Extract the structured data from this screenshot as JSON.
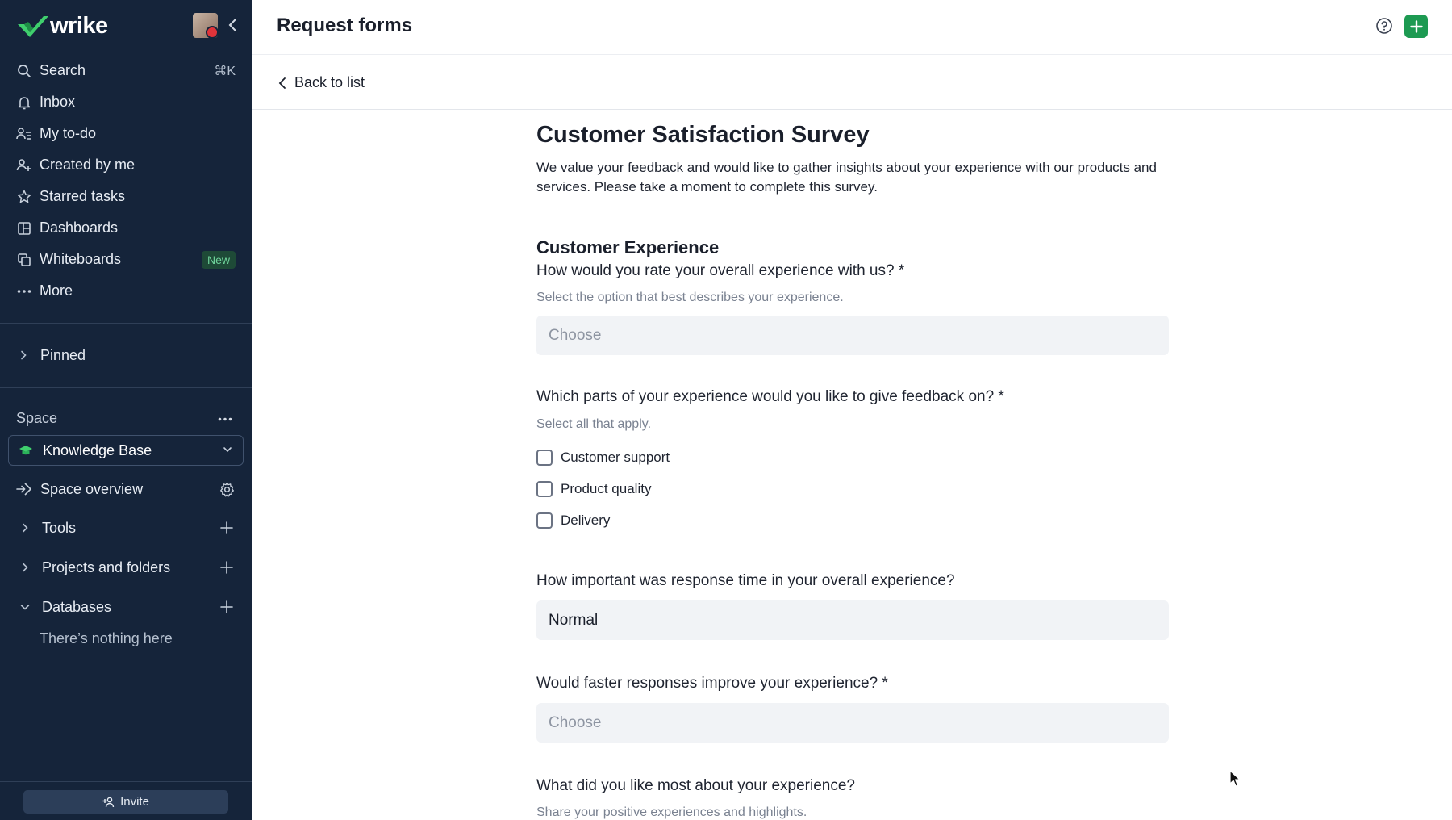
{
  "sidebar": {
    "brand": "wrike",
    "nav": [
      {
        "label": "Search",
        "icon": "search-icon",
        "shortcut": "⌘K"
      },
      {
        "label": "Inbox",
        "icon": "bell-icon"
      },
      {
        "label": "My to-do",
        "icon": "person-list-icon"
      },
      {
        "label": "Created by me",
        "icon": "person-plus-icon"
      },
      {
        "label": "Starred tasks",
        "icon": "star-icon"
      },
      {
        "label": "Dashboards",
        "icon": "dashboard-icon"
      },
      {
        "label": "Whiteboards",
        "icon": "whiteboard-icon",
        "badge": "New"
      },
      {
        "label": "More",
        "icon": "more-dots-icon"
      }
    ],
    "pinned_label": "Pinned",
    "space_label": "Space",
    "space_name": "Knowledge Base",
    "space_overview": "Space overview",
    "tools": "Tools",
    "projects": "Projects and folders",
    "databases": "Databases",
    "databases_empty": "There’s nothing here",
    "invite": "Invite"
  },
  "header": {
    "title": "Request forms",
    "back": "Back to list"
  },
  "form": {
    "title": "Customer Satisfaction Survey",
    "description": "We value your feedback and would like to gather insights about your experience with our products and services. Please take a moment to complete this survey.",
    "section": "Customer Experience",
    "q1": {
      "label": "How would you rate your overall experience with us? *",
      "hint": "Select the option that best describes your experience.",
      "placeholder": "Choose"
    },
    "q2": {
      "label": "Which parts of your experience would you like to give feedback on? *",
      "hint": "Select all that apply.",
      "options": [
        "Customer support",
        "Product quality",
        "Delivery"
      ]
    },
    "q3": {
      "label": "How important was response time in your overall experience?",
      "value": "Normal"
    },
    "q4": {
      "label": "Would faster responses improve your experience? *",
      "placeholder": "Choose"
    },
    "q5": {
      "label": "What did you like most about your experience?",
      "hint": "Share your positive experiences and highlights."
    }
  },
  "colors": {
    "sidebar_bg": "#15243a",
    "accent_green": "#1d9a52",
    "field_bg": "#f1f3f6"
  }
}
